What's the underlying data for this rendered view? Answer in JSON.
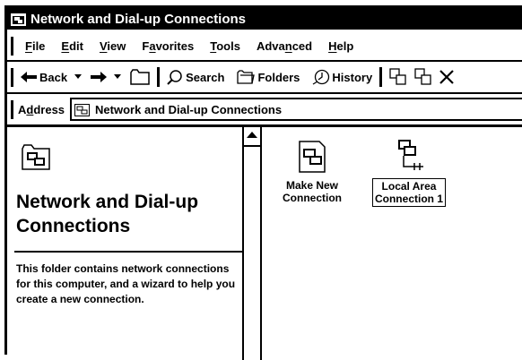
{
  "window": {
    "title": "Network and Dial-up Connections"
  },
  "menu": [
    {
      "pre": "",
      "u": "F",
      "post": "ile"
    },
    {
      "pre": "",
      "u": "E",
      "post": "dit"
    },
    {
      "pre": "",
      "u": "V",
      "post": "iew"
    },
    {
      "pre": "F",
      "u": "a",
      "post": "vorites"
    },
    {
      "pre": "",
      "u": "T",
      "post": "ools"
    },
    {
      "pre": "Adva",
      "u": "n",
      "post": "ced"
    },
    {
      "pre": "",
      "u": "H",
      "post": "elp"
    }
  ],
  "toolbar": {
    "back_label": "Back",
    "search_label": "Search",
    "folders_label": "Folders",
    "history_label": "History"
  },
  "address": {
    "label_pre": "A",
    "label_u": "d",
    "label_post": "dress",
    "value": "Network and Dial-up Connections"
  },
  "left_pane": {
    "title": "Network and Dial-up Connections",
    "description": "This folder contains network connections for this computer, and a wizard to help you create a new connection."
  },
  "items": [
    {
      "label_line1": "Make New",
      "label_line2": "Connection",
      "icon": "make-new-connection-icon"
    },
    {
      "label_line1": "Local Area",
      "label_line2": "Connection 1",
      "icon": "local-area-connection-icon"
    }
  ]
}
